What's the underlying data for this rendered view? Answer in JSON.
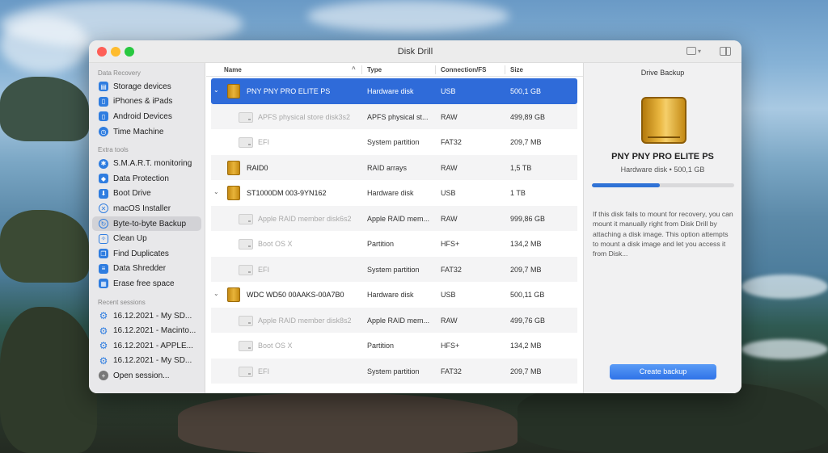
{
  "window": {
    "title": "Disk Drill"
  },
  "sidebar": {
    "sections": [
      {
        "heading": "Data Recovery",
        "items": [
          {
            "label": "Storage devices",
            "icon": "storage-icon"
          },
          {
            "label": "iPhones & iPads",
            "icon": "iphone-icon"
          },
          {
            "label": "Android Devices",
            "icon": "android-icon"
          },
          {
            "label": "Time Machine",
            "icon": "time-machine-icon"
          }
        ]
      },
      {
        "heading": "Extra tools",
        "items": [
          {
            "label": "S.M.A.R.T. monitoring",
            "icon": "smart-icon"
          },
          {
            "label": "Data Protection",
            "icon": "shield-icon"
          },
          {
            "label": "Boot Drive",
            "icon": "boot-drive-icon"
          },
          {
            "label": "macOS Installer",
            "icon": "macos-installer-icon"
          },
          {
            "label": "Byte-to-byte Backup",
            "icon": "backup-icon",
            "active": true
          },
          {
            "label": "Clean Up",
            "icon": "cleanup-icon"
          },
          {
            "label": "Find Duplicates",
            "icon": "duplicates-icon"
          },
          {
            "label": "Data Shredder",
            "icon": "shredder-icon"
          },
          {
            "label": "Erase free space",
            "icon": "erase-icon"
          }
        ]
      },
      {
        "heading": "Recent sessions",
        "items": [
          {
            "label": "16.12.2021 - My SD...",
            "icon": "gear-icon"
          },
          {
            "label": "16.12.2021 - Macinto...",
            "icon": "gear-icon"
          },
          {
            "label": "16.12.2021 - APPLE...",
            "icon": "gear-icon"
          },
          {
            "label": "16.12.2021 - My SD...",
            "icon": "gear-icon"
          },
          {
            "label": "Open session...",
            "icon": "plus-icon"
          }
        ]
      }
    ]
  },
  "table": {
    "columns": {
      "name": "Name",
      "type": "Type",
      "conn": "Connection/FS",
      "size": "Size"
    },
    "rows": [
      {
        "name": "PNY PNY PRO ELITE PS",
        "type": "Hardware disk",
        "conn": "USB",
        "size": "500,1 GB",
        "kind": "disk",
        "expanded": true,
        "selected": true
      },
      {
        "name": "APFS physical store disk3s2",
        "type": "APFS physical st...",
        "conn": "RAW",
        "size": "499,89 GB",
        "kind": "partition"
      },
      {
        "name": "EFI",
        "type": "System partition",
        "conn": "FAT32",
        "size": "209,7 MB",
        "kind": "partition"
      },
      {
        "name": "RAID0",
        "type": "RAID arrays",
        "conn": "RAW",
        "size": "1,5 TB",
        "kind": "disk"
      },
      {
        "name": "ST1000DM 003-9YN162",
        "type": "Hardware disk",
        "conn": "USB",
        "size": "1 TB",
        "kind": "disk",
        "expanded": true
      },
      {
        "name": "Apple RAID member disk6s2",
        "type": "Apple RAID mem...",
        "conn": "RAW",
        "size": "999,86 GB",
        "kind": "partition"
      },
      {
        "name": "Boot OS X",
        "type": "Partition",
        "conn": "HFS+",
        "size": "134,2 MB",
        "kind": "partition"
      },
      {
        "name": "EFI",
        "type": "System partition",
        "conn": "FAT32",
        "size": "209,7 MB",
        "kind": "partition"
      },
      {
        "name": "WDC WD50 00AAKS-00A7B0",
        "type": "Hardware disk",
        "conn": "USB",
        "size": "500,11 GB",
        "kind": "disk",
        "expanded": true
      },
      {
        "name": "Apple RAID member disk8s2",
        "type": "Apple RAID mem...",
        "conn": "RAW",
        "size": "499,76 GB",
        "kind": "partition"
      },
      {
        "name": "Boot OS X",
        "type": "Partition",
        "conn": "HFS+",
        "size": "134,2 MB",
        "kind": "partition"
      },
      {
        "name": "EFI",
        "type": "System partition",
        "conn": "FAT32",
        "size": "209,7 MB",
        "kind": "partition"
      }
    ]
  },
  "detail": {
    "title": "Drive Backup",
    "disk_name": "PNY PNY PRO ELITE PS",
    "disk_sub": "Hardware disk • 500,1 GB",
    "progress_fraction": 0.48,
    "description": "If this disk fails to mount for recovery, you can mount it manually right from Disk Drill by attaching a disk image. This option attempts to mount a disk image and let you access it from Disk...",
    "button": "Create backup"
  },
  "colors": {
    "accent": "#2f6bd9",
    "button": "#2f73e8",
    "disk_gold": "#e8b43a"
  }
}
